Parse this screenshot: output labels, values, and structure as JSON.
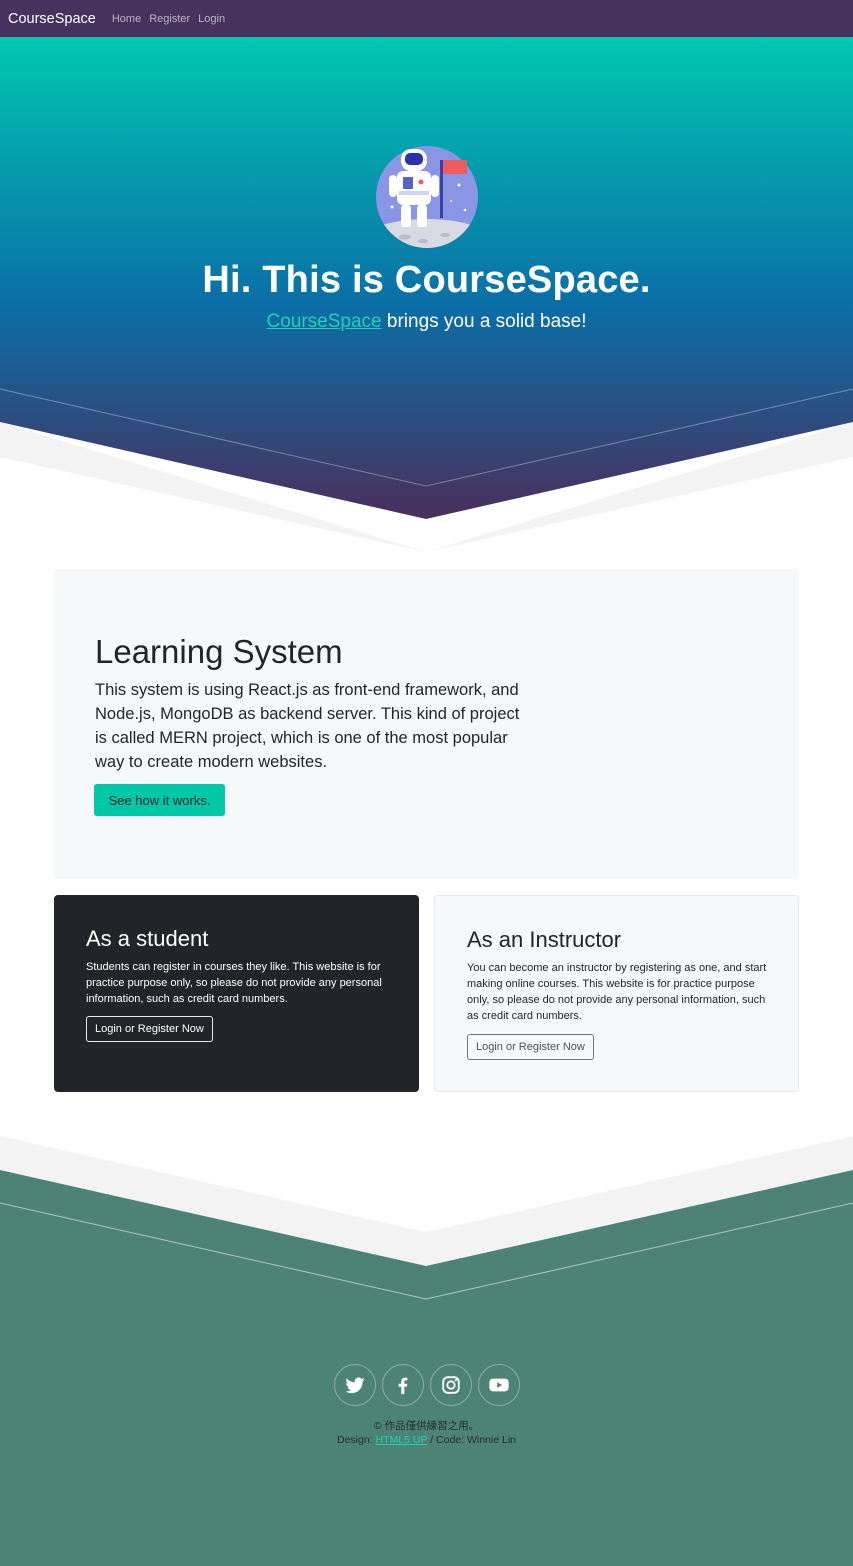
{
  "navbar": {
    "brand": "CourseSpace",
    "links": [
      "Home",
      "Register",
      "Login"
    ]
  },
  "hero": {
    "avatar_icon": "astronaut-icon",
    "title": "Hi. This is CourseSpace.",
    "subtitle_link": "CourseSpace",
    "subtitle_rest": " brings you a solid base!",
    "gradient": [
      "#00c8b0",
      "#0a6fa7",
      "#4a2f5c"
    ]
  },
  "jumbotron": {
    "title": "Learning System",
    "text": "This system is using React.js as front-end framework, and Node.js, MongoDB as backend server. This kind of project is called MERN project, which is one of the most popular way to create modern websites.",
    "button": "See how it works."
  },
  "cards": [
    {
      "title": "As a student",
      "text": "Students can register in courses they like. This website is for practice purpose only, so please do not provide any personal information, such as credit card numbers.",
      "button": "Login or Register Now"
    },
    {
      "title": "As an Instructor",
      "text": "You can become an instructor by registering as one, and start making online courses. This website is for practice purpose only, so please do not provide any personal information, such as credit card numbers.",
      "button": "Login or Register Now"
    }
  ],
  "footer": {
    "social_icons": [
      "twitter-icon",
      "facebook-icon",
      "instagram-icon",
      "youtube-icon"
    ],
    "copyright": "© 作品僅供練習之用。",
    "design_label": "Design: ",
    "design_link": "HTML5 UP",
    "code_label": " / Code: Winnie Lin",
    "background": "#4d8277"
  },
  "colors": {
    "accent": "#00c7a8",
    "navbar": "#47325e",
    "dark_card": "#212428",
    "light_bg": "#f7f8fa"
  }
}
